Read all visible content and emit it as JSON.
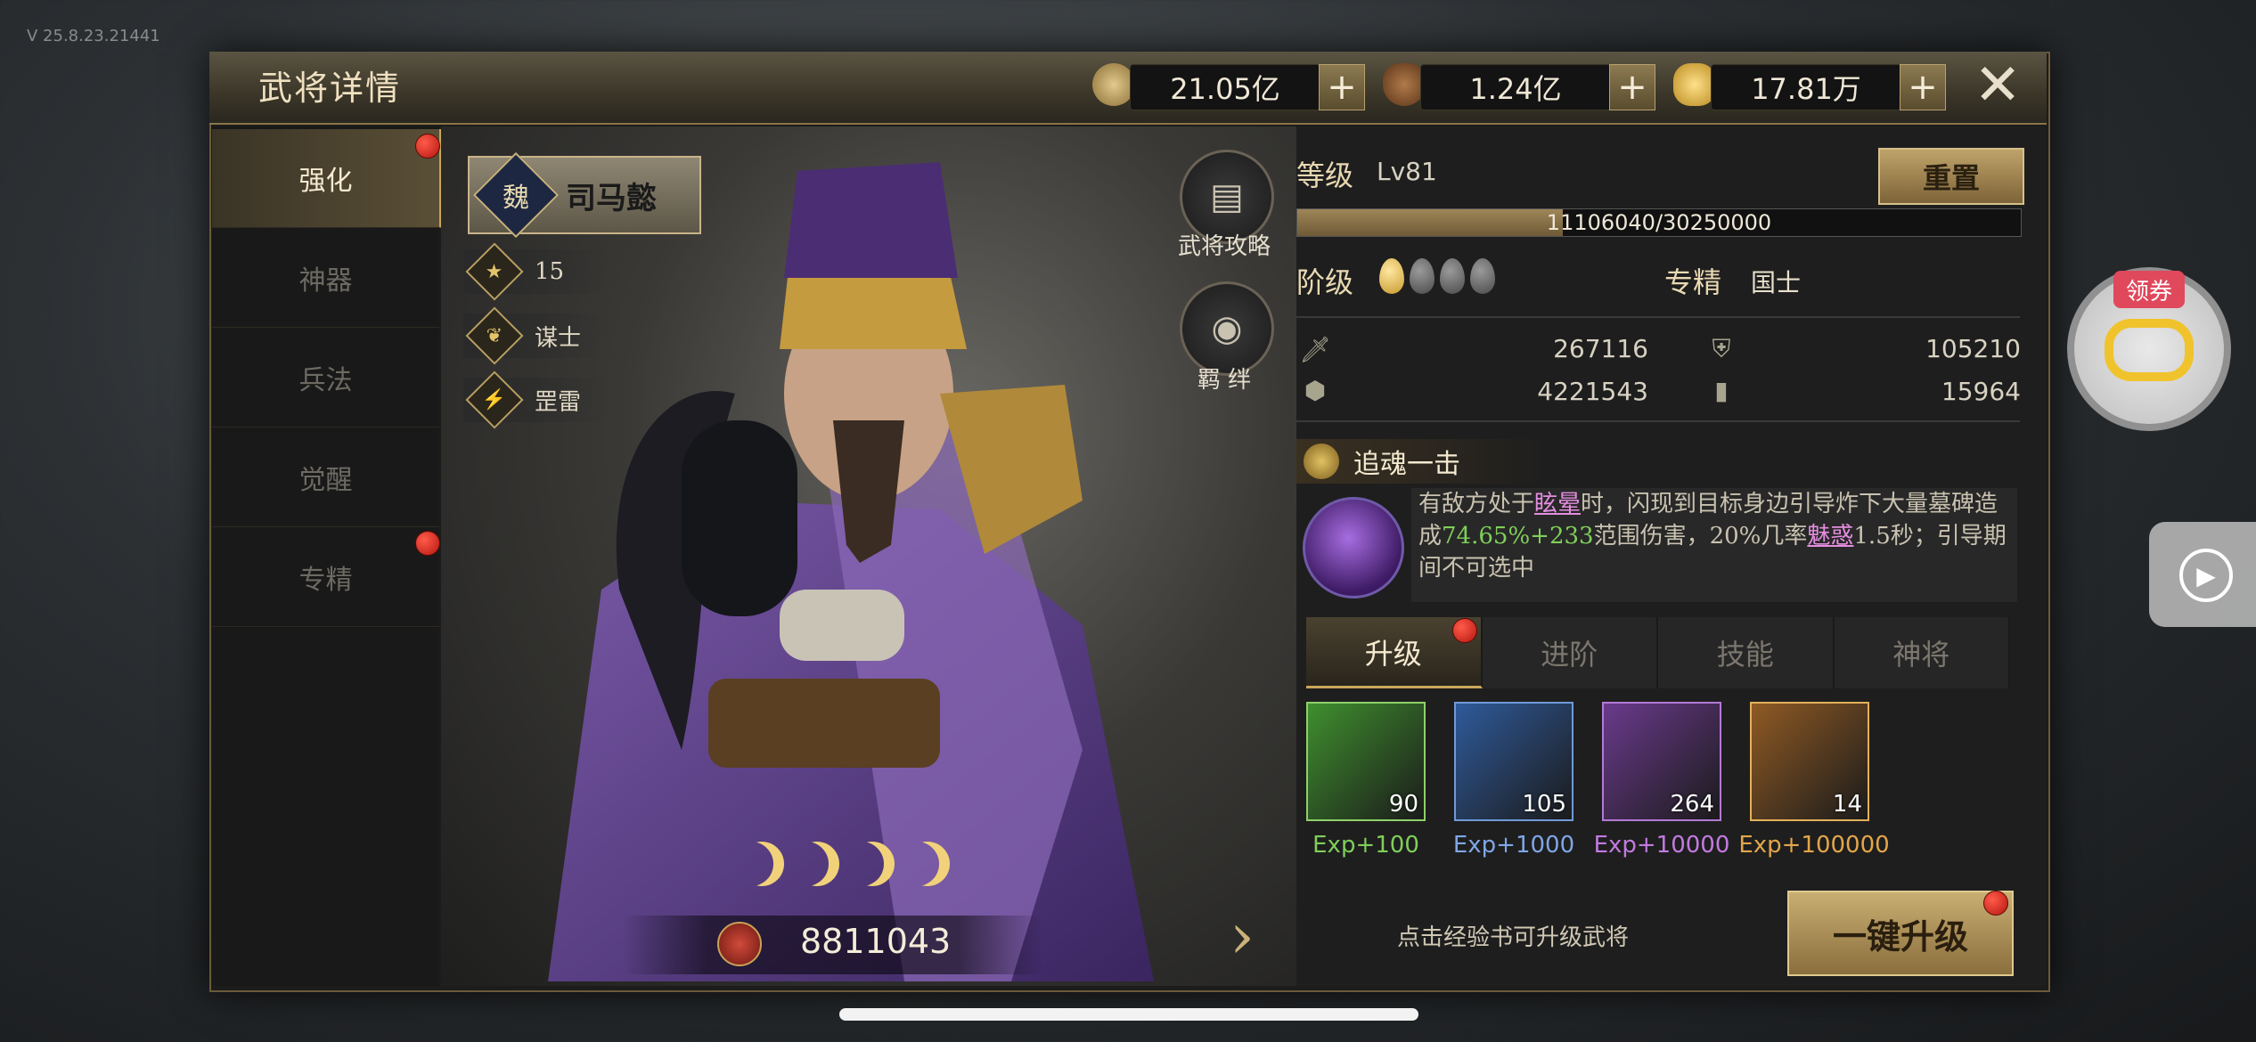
{
  "version": "V 25.8.23.21441",
  "header": {
    "title": "武将详情",
    "currencies": [
      {
        "icon": "copper-coin-icon",
        "value": "21.05亿"
      },
      {
        "icon": "money-bag-icon",
        "value": "1.24亿"
      },
      {
        "icon": "gold-ingot-icon",
        "value": "17.81万"
      }
    ],
    "close_label": "✕"
  },
  "sidebar": {
    "items": [
      {
        "label": "强化",
        "active": true,
        "badge": true
      },
      {
        "label": "神器",
        "active": false,
        "badge": false
      },
      {
        "label": "兵法",
        "active": false,
        "badge": false
      },
      {
        "label": "觉醒",
        "active": false,
        "badge": false
      },
      {
        "label": "专精",
        "active": false,
        "badge": true
      }
    ]
  },
  "hero": {
    "faction": "魏",
    "name": "司马懿",
    "star_count": "15",
    "class": "谋士",
    "element": "罡雷",
    "strategy_label": "武将攻略",
    "bond_label": "羁 绊",
    "moons": 4,
    "power": "8811043"
  },
  "stats": {
    "level_label": "等级",
    "level_value": "Lv81",
    "reset_label": "重置",
    "exp_text": "11106040/30250000",
    "exp_progress": 0.367,
    "rank_label": "阶级",
    "rank_drops": {
      "filled": 1,
      "total": 4
    },
    "specialty_label": "专精",
    "specialty_value": "国士",
    "attack": "267116",
    "defense": "105210",
    "hp": "4221543",
    "speed": "15964"
  },
  "skill": {
    "name": "追魂一击",
    "desc_parts": [
      {
        "text": "有敌方处于",
        "style": "normal"
      },
      {
        "text": "眩晕",
        "style": "purple"
      },
      {
        "text": "时，闪现到目标身边引导炸下大量墓碑造成",
        "style": "normal"
      },
      {
        "text": "74.65%+233",
        "style": "green"
      },
      {
        "text": "范围伤害，20%几率",
        "style": "normal"
      },
      {
        "text": "魅惑",
        "style": "purple"
      },
      {
        "text": "1.5秒；引导期间不可选中",
        "style": "normal"
      }
    ]
  },
  "tabs": [
    {
      "label": "升级",
      "active": true,
      "badge": true
    },
    {
      "label": "进阶",
      "active": false,
      "badge": false
    },
    {
      "label": "技能",
      "active": false,
      "badge": false
    },
    {
      "label": "神将",
      "active": false,
      "badge": false
    }
  ],
  "books": [
    {
      "count": "90",
      "exp": "Exp+100",
      "color": "#3f8f2e",
      "border": "#8ed16a",
      "text_color": "#7fcf5a"
    },
    {
      "count": "105",
      "exp": "Exp+1000",
      "color": "#2f5a9a",
      "border": "#6f9ad8",
      "text_color": "#7fa6e6"
    },
    {
      "count": "264",
      "exp": "Exp+10000",
      "color": "#6a3a8c",
      "border": "#b27ad6",
      "text_color": "#c27ae0"
    },
    {
      "count": "14",
      "exp": "Exp+100000",
      "color": "#8f5a24",
      "border": "#e3b15a",
      "text_color": "#e3a64a"
    }
  ],
  "footer": {
    "hint": "点击经验书可升级武将",
    "upgrade_label": "一键升级"
  },
  "overlay": {
    "coupon_label": "领券"
  }
}
